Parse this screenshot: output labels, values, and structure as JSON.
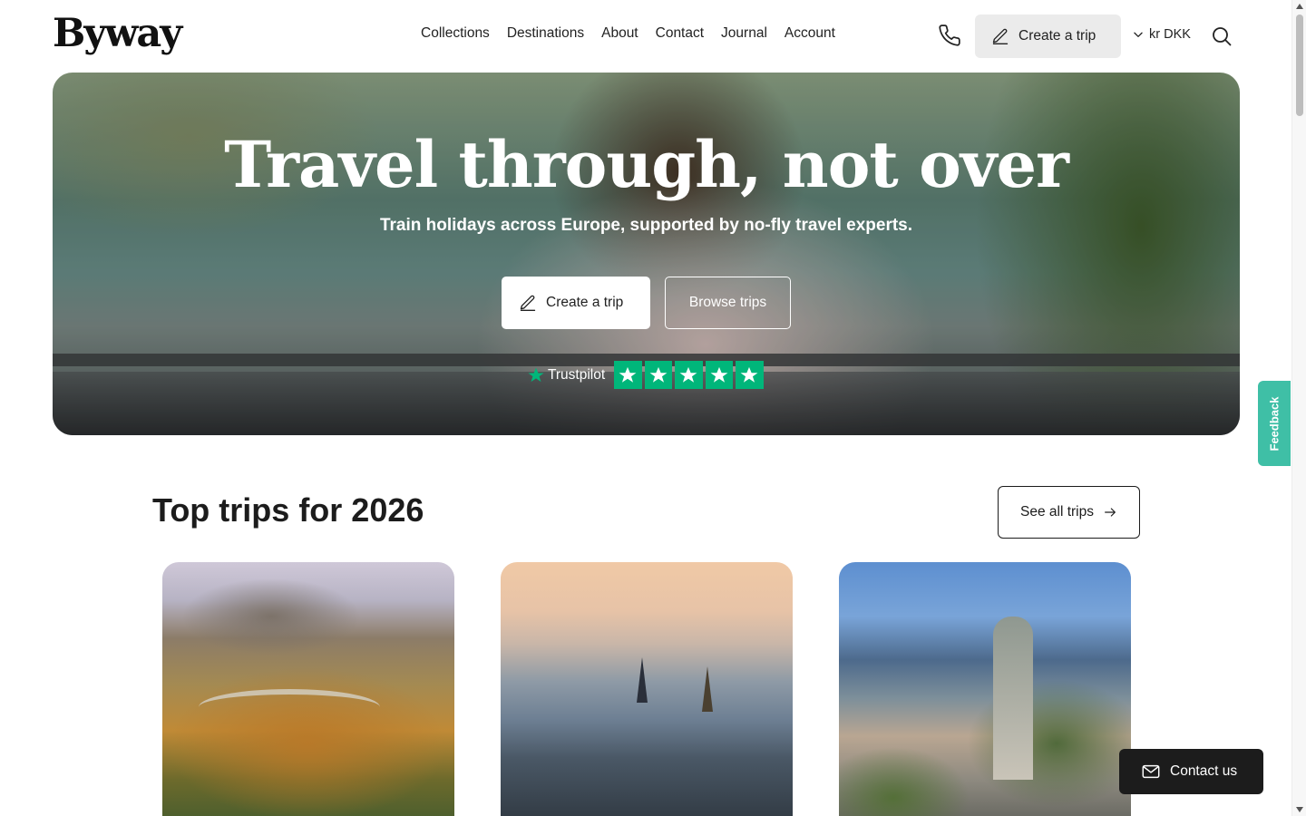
{
  "header": {
    "logo": "Byway",
    "nav": [
      "Collections",
      "Destinations",
      "About",
      "Contact",
      "Journal",
      "Account"
    ],
    "create_trip_label": "Create a trip",
    "currency_label": "kr DKK"
  },
  "hero": {
    "title": "Travel through, not over",
    "subtitle": "Train holidays across Europe, supported by no-fly travel experts.",
    "create_trip_label": "Create a trip",
    "browse_trips_label": "Browse trips",
    "trustpilot_label": "Trustpilot",
    "trustpilot_stars": 5
  },
  "top_trips": {
    "title": "Top trips for 2026",
    "see_all_label": "See all trips"
  },
  "widgets": {
    "feedback_label": "Feedback",
    "contact_us_label": "Contact us"
  },
  "colors": {
    "accent_teal": "#3fbfa6",
    "trustpilot_green": "#00b67a",
    "dark": "#1c1c1c"
  }
}
